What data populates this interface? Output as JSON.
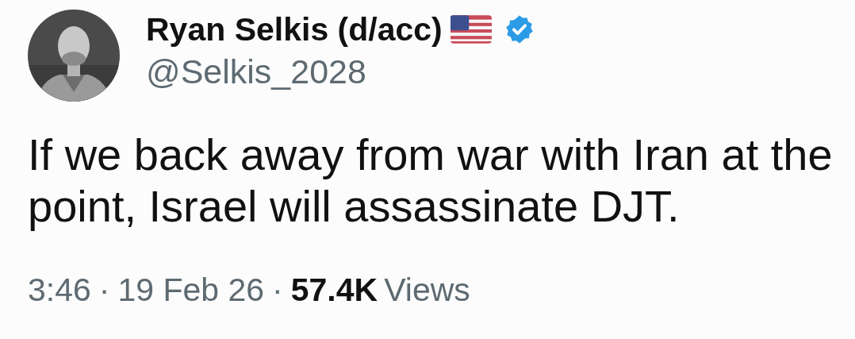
{
  "author": {
    "name": "Ryan Selkis (d/acc)",
    "flag": true,
    "verified": true,
    "handle": "@Selkis_2028"
  },
  "body": "If we back away from war with Iran at the point, Israel will assassinate DJT.",
  "meta": [
    {
      "kind": "time",
      "text": "3:46"
    },
    {
      "kind": "separator",
      "text": "·"
    },
    {
      "kind": "date",
      "text": "19 Feb 26"
    },
    {
      "kind": "separator",
      "text": "·"
    },
    {
      "kind": "count",
      "text": "57.4K"
    },
    {
      "kind": "label",
      "text": "Views"
    }
  ]
}
